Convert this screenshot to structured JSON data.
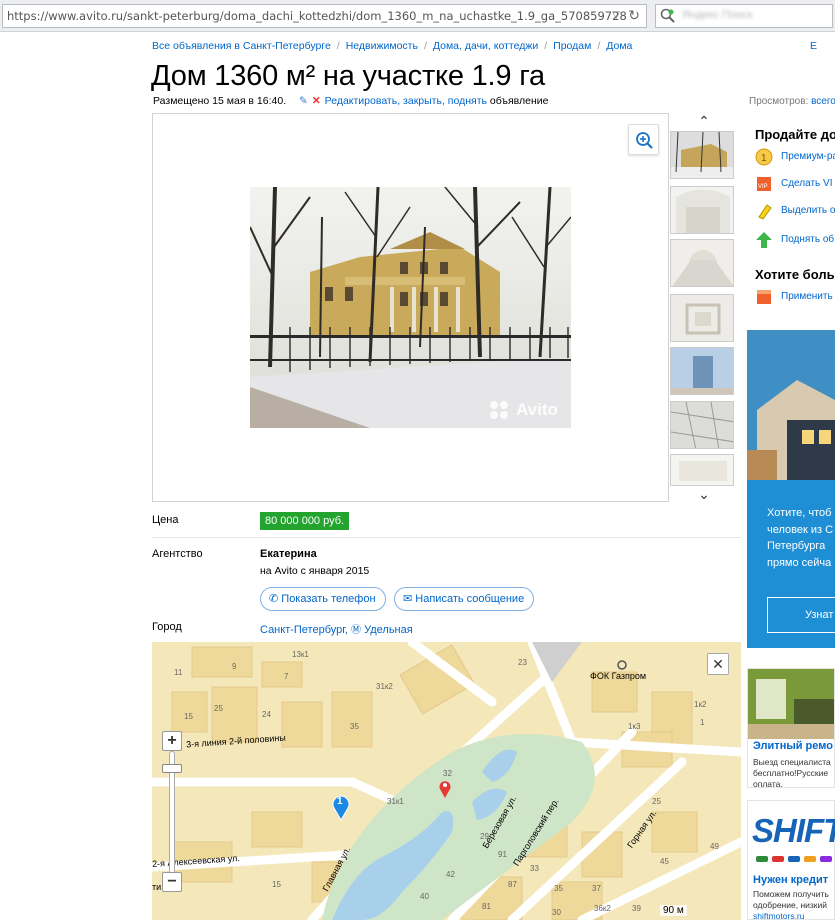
{
  "browser": {
    "url": "https://www.avito.ru/sankt-peterburg/doma_dachi_kottedzhi/dom_1360_m_na_uchastke_1.9_ga_570859728",
    "search_placeholder": "Яндекс Поиск"
  },
  "breadcrumb": [
    "Все объявления в Санкт-Петербурге",
    "Недвижимость",
    "Дома, дачи, коттеджи",
    "Продам",
    "Дома"
  ],
  "breadcrumb_right": "Е",
  "title": "Дом 1360 м² на участке 1.9 га",
  "meta": {
    "posted": "Размещено 15 мая в 16:40.",
    "edit_link": "Редактировать, закрыть, поднять",
    "edit_suffix": " объявление"
  },
  "views": {
    "label": "Просмотров:",
    "link": "всего"
  },
  "gallery": {
    "watermark": "Avito",
    "thumb_count": 7
  },
  "price": {
    "label": "Цена",
    "value": "80 000 000 руб."
  },
  "agency": {
    "label": "Агентство",
    "name": "Екатерина",
    "since": "на Avito с января 2015",
    "show_phone": "Показать телефон",
    "write_message": "Написать сообщение"
  },
  "city": {
    "label": "Город",
    "name": "Санкт-Петербург,",
    "metro": "Удельная"
  },
  "map": {
    "scale": "90 м",
    "labels": {
      "fok": "ФОК Газпром",
      "line": "3-я линия 2-й половины",
      "alexeevskaya": "2-я Алексеевская ул.",
      "glavnaya": "Главная ул.",
      "berezovaya": "Березовая ул.",
      "pargolovsky": "Парголовский пер.",
      "gornaya": "Горная ул.",
      "ul": "ти ул.",
      "n11": "11",
      "n13k1": "13к1",
      "n9": "9",
      "n7": "7",
      "n15": "15",
      "n25a": "25",
      "n24": "24",
      "n35a": "35",
      "n31k2": "31к2",
      "n23": "23",
      "n1k3": "1к3",
      "n1k2": "1к2",
      "n1": "1",
      "n31k1": "31к1",
      "n32": "32",
      "n25": "25",
      "n45": "45",
      "n49": "49",
      "n37": "37",
      "n35": "35",
      "n33": "33",
      "n29": "29",
      "n91": "91",
      "n42": "42",
      "n40": "40",
      "n87": "87",
      "n81": "81",
      "n39": "39",
      "n36k2": "36к2",
      "n30": "30",
      "n15b": "15",
      "marker": "1"
    }
  },
  "right": {
    "sell_heading": "Продайте до",
    "services": [
      {
        "label": "Премиум-ра",
        "icon": "premium-icon"
      },
      {
        "label": "Сделать VI",
        "icon": "vip-icon"
      },
      {
        "label": "Выделить о",
        "icon": "highlight-icon"
      },
      {
        "label": "Поднять об",
        "icon": "raise-icon"
      }
    ],
    "want_heading": "Хотите боль",
    "apply_service": {
      "label": "Применить",
      "icon": "package-icon"
    }
  },
  "ads": {
    "blue": {
      "lines": [
        "Хотите, чтоб",
        "человек из С",
        "Петербурга",
        "прямо сейча"
      ],
      "button": "Узнат"
    },
    "remont": {
      "title": "Элитный ремо",
      "lines": [
        "Выезд специалиста",
        "бесплатно!Русские",
        "оплата."
      ]
    },
    "shift": {
      "logo": "SHIFT",
      "title": "Нужен кредит",
      "lines": [
        "Поможем получить",
        "одобрение, низкий"
      ],
      "url": "shiftmotors.ru"
    }
  }
}
